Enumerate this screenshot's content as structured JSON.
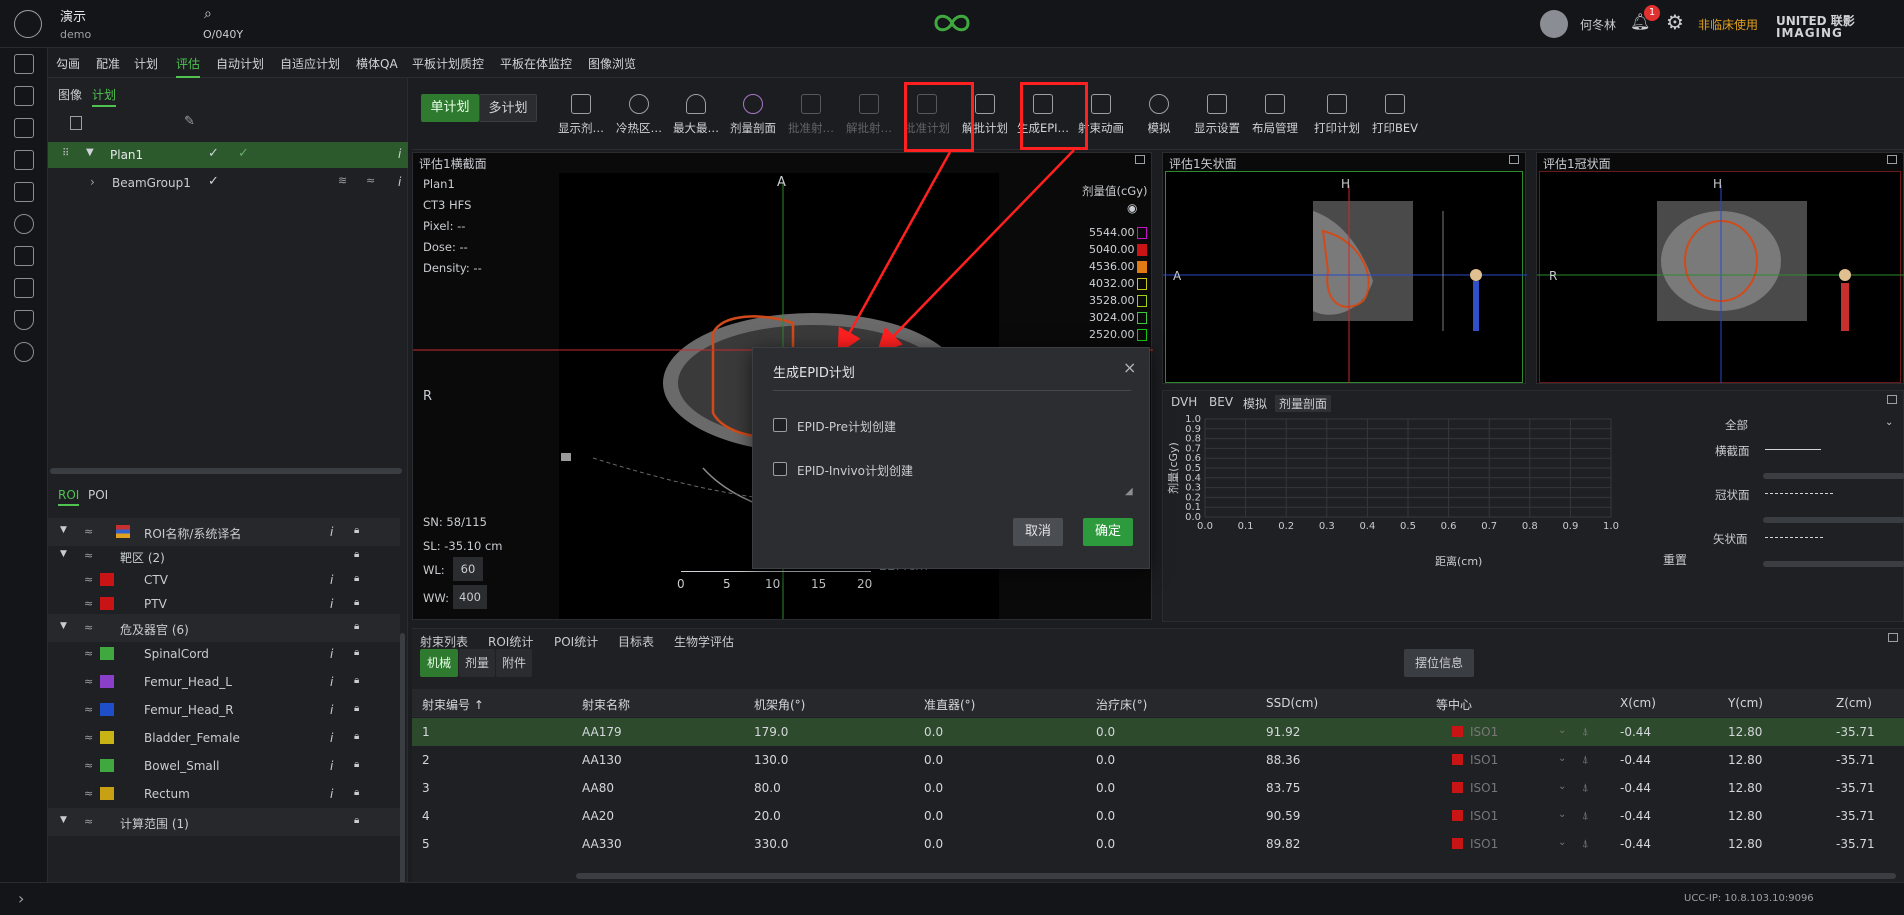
{
  "header": {
    "user_name": "演示",
    "user_sub": "demo",
    "patient_id": "O/040Y",
    "operator": "何冬林",
    "notification_count": "1",
    "non_clinical": "非临床使用",
    "brand_line1": "UNITED 联影",
    "brand_line2": "IMAGING"
  },
  "menu": [
    "勾画",
    "配准",
    "计划",
    "评估",
    "自动计划",
    "自适应计划",
    "横体QA",
    "平板计划质控",
    "平板在体监控",
    "图像浏览"
  ],
  "left_tabs": {
    "image": "图像",
    "plan": "计划"
  },
  "plan_tree": {
    "plan": "Plan1",
    "beam_group": "BeamGroup1"
  },
  "roi_tabs": {
    "roi": "ROI",
    "poi": "POI"
  },
  "roi_header": "ROI名称/系统译名",
  "roi_groups": [
    {
      "label": "靶区 (2)"
    },
    {
      "label": "危及器官 (6)"
    },
    {
      "label": "计算范围 (1)"
    }
  ],
  "rois": [
    {
      "name": "CTV",
      "color": "#c81414"
    },
    {
      "name": "PTV",
      "color": "#c81414"
    },
    {
      "name": "SpinalCord",
      "color": "#3fa83f"
    },
    {
      "name": "Femur_Head_L",
      "color": "#8a3fc8"
    },
    {
      "name": "Femur_Head_R",
      "color": "#1f4fc8"
    },
    {
      "name": "Bladder_Female",
      "color": "#c8b414"
    },
    {
      "name": "Bowel_Small",
      "color": "#3fa83f"
    },
    {
      "name": "Rectum",
      "color": "#c8a014"
    }
  ],
  "plan_mode": {
    "single": "单计划",
    "multi": "多计划"
  },
  "tools": [
    {
      "label": "显示剂…",
      "disabled": false
    },
    {
      "label": "冷热区…",
      "disabled": false
    },
    {
      "label": "最大最…",
      "disabled": false
    },
    {
      "label": "剂量剖面",
      "disabled": false
    },
    {
      "label": "批准射…",
      "disabled": true
    },
    {
      "label": "解批射…",
      "disabled": true
    },
    {
      "label": "批准计划",
      "disabled": true
    },
    {
      "label": "解批计划",
      "disabled": false
    },
    {
      "label": "生成EPI…",
      "disabled": false
    },
    {
      "label": "射束动画",
      "disabled": false
    },
    {
      "label": "模拟",
      "disabled": false
    },
    {
      "label": "显示设置",
      "disabled": false
    },
    {
      "label": "布局管理",
      "disabled": false
    },
    {
      "label": "打印计划",
      "disabled": false
    },
    {
      "label": "打印BEV",
      "disabled": false
    }
  ],
  "axial": {
    "title": "评估1横截面",
    "plan": "Plan1",
    "series": "CT3 HFS",
    "pixel": "Pixel: --",
    "dose": "Dose: --",
    "density": "Density: --",
    "orient_top": "A",
    "orient_left": "R",
    "sn": "SN: 58/115",
    "sl": "SL: -35.10 cm",
    "wl_label": "WL:",
    "wl": "60",
    "ww_label": "WW:",
    "ww": "400",
    "dose_title": "剂量值(cGy)",
    "dose_levels": [
      {
        "v": "5544.00",
        "c": "#c814c8"
      },
      {
        "v": "5040.00",
        "c": "#c81414"
      },
      {
        "v": "4536.00",
        "c": "#e07a14"
      },
      {
        "v": "4032.00",
        "c": "#c8c814"
      },
      {
        "v": "3528.00",
        "c": "#a0d014"
      },
      {
        "v": "3024.00",
        "c": "#3fc83f"
      },
      {
        "v": "2520.00",
        "c": "#14c814"
      }
    ],
    "ruler": [
      "0",
      "5",
      "10",
      "15",
      "20"
    ],
    "ruler_unit": "22.4cm"
  },
  "sagittal": {
    "title": "评估1矢状面",
    "top": "H",
    "left": "A"
  },
  "coronal": {
    "title": "评估1冠状面",
    "top": "H",
    "left": "R"
  },
  "analysis_tabs": [
    "DVH",
    "BEV",
    "模拟",
    "剂量剖面"
  ],
  "profile": {
    "ylabel": "剂量(cGy)",
    "xlabel": "距离(cm)",
    "yticks": [
      "1.0",
      "0.9",
      "0.8",
      "0.7",
      "0.6",
      "0.5",
      "0.4",
      "0.3",
      "0.2",
      "0.1",
      "0.0"
    ],
    "xticks": [
      "0.0",
      "0.1",
      "0.2",
      "0.3",
      "0.4",
      "0.5",
      "0.6",
      "0.7",
      "0.8",
      "0.9",
      "1.0"
    ],
    "reset": "重置",
    "all": "全部",
    "legend": [
      "横截面",
      "冠状面",
      "矢状面"
    ]
  },
  "bottom_tabs": [
    "射束列表",
    "ROI统计",
    "POI统计",
    "目标表",
    "生物学评估"
  ],
  "sub_tabs": [
    "机械",
    "剂量",
    "附件"
  ],
  "setup_info": "摆位信息",
  "table": {
    "headers": [
      "射束编号 ↑",
      "射束名称",
      "机架角(°)",
      "准直器(°)",
      "治疗床(°)",
      "SSD(cm)",
      "等中心",
      "X(cm)",
      "Y(cm)",
      "Z(cm)"
    ],
    "rows": [
      [
        "1",
        "AA179",
        "179.0",
        "0.0",
        "0.0",
        "91.92",
        "ISO1",
        "-0.44",
        "12.80",
        "-35.71"
      ],
      [
        "2",
        "AA130",
        "130.0",
        "0.0",
        "0.0",
        "88.36",
        "ISO1",
        "-0.44",
        "12.80",
        "-35.71"
      ],
      [
        "3",
        "AA80",
        "80.0",
        "0.0",
        "0.0",
        "83.75",
        "ISO1",
        "-0.44",
        "12.80",
        "-35.71"
      ],
      [
        "4",
        "AA20",
        "20.0",
        "0.0",
        "0.0",
        "90.59",
        "ISO1",
        "-0.44",
        "12.80",
        "-35.71"
      ],
      [
        "5",
        "AA330",
        "330.0",
        "0.0",
        "0.0",
        "89.82",
        "ISO1",
        "-0.44",
        "12.80",
        "-35.71"
      ]
    ]
  },
  "status_ip": "UCC-IP: 10.8.103.10:9096",
  "modal": {
    "title": "生成EPID计划",
    "opt1": "EPID-Pre计划创建",
    "opt2": "EPID-Invivo计划创建",
    "cancel": "取消",
    "ok": "确定"
  },
  "colors": {
    "accent": "#3fa83f",
    "annotation": "#ff2020"
  }
}
